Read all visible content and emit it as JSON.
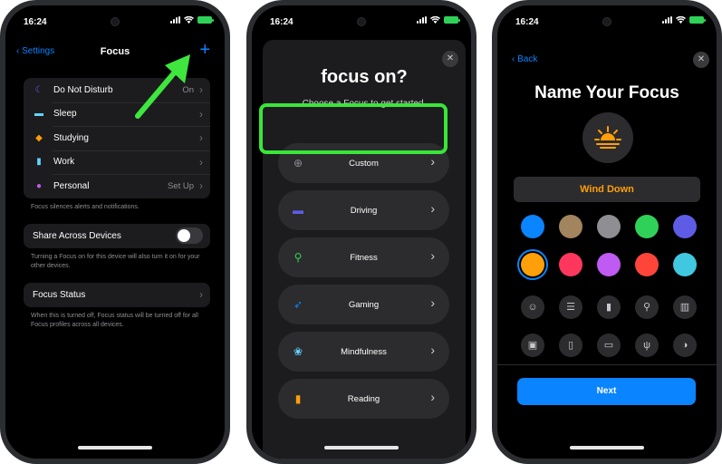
{
  "phone1": {
    "status": {
      "time": "16:24"
    },
    "nav": {
      "back_label": "Settings",
      "title": "Focus",
      "add_icon": "plus-icon"
    },
    "focus_list": [
      {
        "icon": "moon-icon",
        "color": "#5e5ce6",
        "label": "Do Not Disturb",
        "value": "On"
      },
      {
        "icon": "bed-icon",
        "color": "#64d2ff",
        "label": "Sleep",
        "value": ""
      },
      {
        "icon": "graduation-cap-icon",
        "color": "#ff9f0a",
        "label": "Studying",
        "value": ""
      },
      {
        "icon": "id-badge-icon",
        "color": "#64d2ff",
        "label": "Work",
        "value": ""
      },
      {
        "icon": "person-icon",
        "color": "#bf5af2",
        "label": "Personal",
        "value": "Set Up"
      }
    ],
    "focus_note": "Focus silences alerts and notifications.",
    "share": {
      "label": "Share Across Devices",
      "on": false,
      "note": "Turning a Focus on for this device will also turn it on for your other devices."
    },
    "status_row": {
      "label": "Focus Status",
      "note": "When this is turned off, Focus status will be turned off for all Focus profiles across all devices."
    }
  },
  "phone2": {
    "status": {
      "time": "16:24"
    },
    "heading": "focus on?",
    "subheading": "Choose a Focus to get started.",
    "options": [
      {
        "icon": "plus-circle-icon",
        "color": "#8e8e93",
        "label": "Custom"
      },
      {
        "icon": "car-icon",
        "color": "#5e5ce6",
        "label": "Driving"
      },
      {
        "icon": "running-icon",
        "color": "#30d158",
        "label": "Fitness"
      },
      {
        "icon": "rocket-icon",
        "color": "#0a84ff",
        "label": "Gaming"
      },
      {
        "icon": "flower-icon",
        "color": "#64d2ff",
        "label": "Mindfulness"
      },
      {
        "icon": "book-icon",
        "color": "#ff9f0a",
        "label": "Reading"
      }
    ]
  },
  "phone3": {
    "status": {
      "time": "16:24"
    },
    "back_label": "Back",
    "title": "Name Your Focus",
    "focus_icon": "sunset-icon",
    "name_value": "Wind Down",
    "accent": "#ff9f0a",
    "colors": [
      "#0a84ff",
      "#a2845e",
      "#8e8e93",
      "#30d158",
      "#5e5ce6",
      "#ff9f0a",
      "#ff375f",
      "#bf5af2",
      "#ff453a",
      "#40c8e0"
    ],
    "selected_color": "#ff9f0a",
    "glyphs": [
      "smiley-icon",
      "list-icon",
      "bookmark-icon",
      "pin-icon",
      "books-icon",
      "gift-icon",
      "document-icon",
      "card-icon",
      "fork-knife-icon",
      "pills-icon"
    ],
    "next_label": "Next"
  }
}
